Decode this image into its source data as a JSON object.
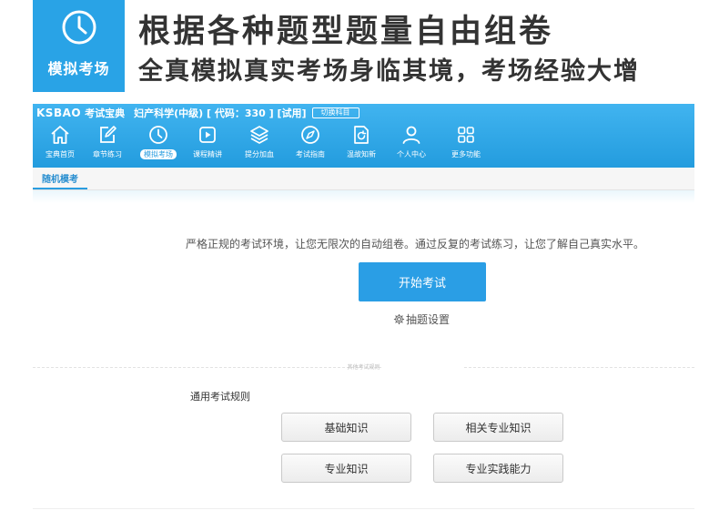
{
  "banner": {
    "badge_icon": "clock-icon",
    "badge_label": "模拟考场",
    "badge_color": "#29a3e6",
    "title": "根据各种题型题量自由组卷",
    "subtitle": "全真模拟真实考场身临其境，考场经验大增"
  },
  "header": {
    "brand": "KSBAO",
    "brand_cn": "考试宝典",
    "subject_line": "妇产科学(中级) [ 代码：330 ] [试用]",
    "switch_label": "切换科目",
    "accent_color": "#2a9ee5"
  },
  "nav": {
    "items": [
      {
        "label": "宝典首页",
        "icon": "home-icon"
      },
      {
        "label": "章节练习",
        "icon": "edit-icon"
      },
      {
        "label": "模拟考场",
        "icon": "clock-icon",
        "active": true
      },
      {
        "label": "课程精讲",
        "icon": "play-icon"
      },
      {
        "label": "提分加血",
        "icon": "layers-icon"
      },
      {
        "label": "考试指南",
        "icon": "compass-icon"
      },
      {
        "label": "温故知新",
        "icon": "refresh-doc-icon"
      },
      {
        "label": "个人中心",
        "icon": "user-icon"
      },
      {
        "label": "更多功能",
        "icon": "grid-icon"
      }
    ]
  },
  "tabs": {
    "active_label": "随机模考"
  },
  "main": {
    "intro": "严格正规的考试环境，让您无限次的自动组卷。通过反复的考试练习，让您了解自己真实水平。",
    "start_button": "开始考试",
    "settings_link": "抽题设置",
    "settings_icon": "gear-icon"
  },
  "rules": {
    "divider_text": "其他考试规则",
    "heading": "通用考试规则",
    "buttons": [
      "基础知识",
      "相关专业知识",
      "专业知识",
      "专业实践能力"
    ]
  }
}
